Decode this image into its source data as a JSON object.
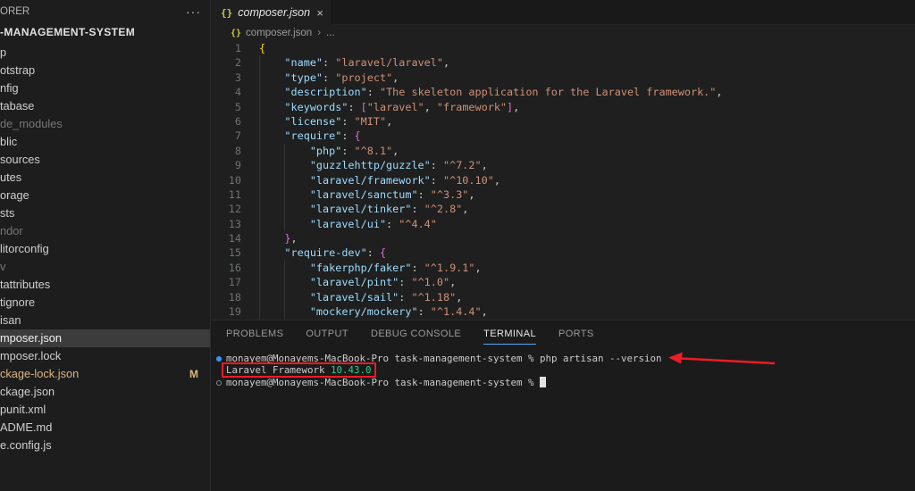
{
  "colors": {
    "annotation_red": "#ed1c24",
    "accent_blue": "#4daafc",
    "version_green": "#23d18b",
    "modified_yellow": "#dcb67f",
    "json_icon_yellow": "#cbcb41",
    "terminal_decoration_blue": "#3794ff"
  },
  "sidebar": {
    "header": "ORER",
    "more_icon": "···",
    "project": "-MANAGEMENT-SYSTEM",
    "items": [
      {
        "label": "p"
      },
      {
        "label": "otstrap"
      },
      {
        "label": "nfig"
      },
      {
        "label": "tabase"
      },
      {
        "label": "de_modules",
        "dim": true
      },
      {
        "label": "blic"
      },
      {
        "label": "sources"
      },
      {
        "label": "utes"
      },
      {
        "label": "orage"
      },
      {
        "label": "sts"
      },
      {
        "label": "ndor",
        "dim": true
      },
      {
        "label": "litorconfig"
      },
      {
        "label": "v",
        "dim": true
      },
      {
        "label": "tattributes"
      },
      {
        "label": "tignore"
      },
      {
        "label": "isan"
      },
      {
        "label": "mposer.json",
        "selected": true
      },
      {
        "label": "mposer.lock"
      },
      {
        "label": "ckage-lock.json",
        "modified": true,
        "badge": "M"
      },
      {
        "label": "ckage.json"
      },
      {
        "label": "punit.xml"
      },
      {
        "label": "ADME.md"
      },
      {
        "label": "e.config.js"
      }
    ]
  },
  "tabbar": {
    "tab": {
      "icon": "{}",
      "label": "composer.json",
      "close": "×"
    }
  },
  "breadcrumb": {
    "icon": "{}",
    "file": "composer.json",
    "separator": "›",
    "tail": "..."
  },
  "editor": {
    "lines": [
      {
        "n": 1,
        "i": 0,
        "t": [
          [
            "{",
            "b1"
          ]
        ]
      },
      {
        "n": 2,
        "i": 4,
        "t": [
          [
            "\"name\"",
            "key"
          ],
          [
            ": ",
            "pun"
          ],
          [
            "\"laravel/laravel\"",
            "str"
          ],
          [
            ",",
            "pun"
          ]
        ]
      },
      {
        "n": 3,
        "i": 4,
        "t": [
          [
            "\"type\"",
            "key"
          ],
          [
            ": ",
            "pun"
          ],
          [
            "\"project\"",
            "str"
          ],
          [
            ",",
            "pun"
          ]
        ]
      },
      {
        "n": 4,
        "i": 4,
        "t": [
          [
            "\"description\"",
            "key"
          ],
          [
            ": ",
            "pun"
          ],
          [
            "\"The skeleton application for the Laravel framework.\"",
            "str"
          ],
          [
            ",",
            "pun"
          ]
        ]
      },
      {
        "n": 5,
        "i": 4,
        "t": [
          [
            "\"keywords\"",
            "key"
          ],
          [
            ": ",
            "pun"
          ],
          [
            "[",
            "b2"
          ],
          [
            "\"laravel\"",
            "str"
          ],
          [
            ", ",
            "pun"
          ],
          [
            "\"framework\"",
            "str"
          ],
          [
            "]",
            "b2"
          ],
          [
            ",",
            "pun"
          ]
        ]
      },
      {
        "n": 6,
        "i": 4,
        "t": [
          [
            "\"license\"",
            "key"
          ],
          [
            ": ",
            "pun"
          ],
          [
            "\"MIT\"",
            "str"
          ],
          [
            ",",
            "pun"
          ]
        ]
      },
      {
        "n": 7,
        "i": 4,
        "t": [
          [
            "\"require\"",
            "key"
          ],
          [
            ": ",
            "pun"
          ],
          [
            "{",
            "b2"
          ]
        ]
      },
      {
        "n": 8,
        "i": 8,
        "t": [
          [
            "\"php\"",
            "key"
          ],
          [
            ": ",
            "pun"
          ],
          [
            "\"^8.1\"",
            "str"
          ],
          [
            ",",
            "pun"
          ]
        ]
      },
      {
        "n": 9,
        "i": 8,
        "t": [
          [
            "\"guzzlehttp/guzzle\"",
            "key"
          ],
          [
            ": ",
            "pun"
          ],
          [
            "\"^7.2\"",
            "str"
          ],
          [
            ",",
            "pun"
          ]
        ]
      },
      {
        "n": 10,
        "i": 8,
        "t": [
          [
            "\"laravel/framework\"",
            "key"
          ],
          [
            ": ",
            "pun"
          ],
          [
            "\"^10.10\"",
            "str"
          ],
          [
            ",",
            "pun"
          ]
        ]
      },
      {
        "n": 11,
        "i": 8,
        "t": [
          [
            "\"laravel/sanctum\"",
            "key"
          ],
          [
            ": ",
            "pun"
          ],
          [
            "\"^3.3\"",
            "str"
          ],
          [
            ",",
            "pun"
          ]
        ]
      },
      {
        "n": 12,
        "i": 8,
        "t": [
          [
            "\"laravel/tinker\"",
            "key"
          ],
          [
            ": ",
            "pun"
          ],
          [
            "\"^2.8\"",
            "str"
          ],
          [
            ",",
            "pun"
          ]
        ]
      },
      {
        "n": 13,
        "i": 8,
        "t": [
          [
            "\"laravel/ui\"",
            "key"
          ],
          [
            ": ",
            "pun"
          ],
          [
            "\"^4.4\"",
            "str"
          ]
        ]
      },
      {
        "n": 14,
        "i": 4,
        "t": [
          [
            "}",
            "b2"
          ],
          [
            ",",
            "pun"
          ]
        ]
      },
      {
        "n": 15,
        "i": 4,
        "t": [
          [
            "\"require-dev\"",
            "key"
          ],
          [
            ": ",
            "pun"
          ],
          [
            "{",
            "b2"
          ]
        ]
      },
      {
        "n": 16,
        "i": 8,
        "t": [
          [
            "\"fakerphp/faker\"",
            "key"
          ],
          [
            ": ",
            "pun"
          ],
          [
            "\"^1.9.1\"",
            "str"
          ],
          [
            ",",
            "pun"
          ]
        ]
      },
      {
        "n": 17,
        "i": 8,
        "t": [
          [
            "\"laravel/pint\"",
            "key"
          ],
          [
            ": ",
            "pun"
          ],
          [
            "\"^1.0\"",
            "str"
          ],
          [
            ",",
            "pun"
          ]
        ]
      },
      {
        "n": 18,
        "i": 8,
        "t": [
          [
            "\"laravel/sail\"",
            "key"
          ],
          [
            ": ",
            "pun"
          ],
          [
            "\"^1.18\"",
            "str"
          ],
          [
            ",",
            "pun"
          ]
        ]
      },
      {
        "n": 19,
        "i": 8,
        "t": [
          [
            "\"mockery/mockery\"",
            "key"
          ],
          [
            ": ",
            "pun"
          ],
          [
            "\"^1.4.4\"",
            "str"
          ],
          [
            ",",
            "pun"
          ]
        ]
      }
    ]
  },
  "panel": {
    "tabs": [
      {
        "label": "PROBLEMS"
      },
      {
        "label": "OUTPUT"
      },
      {
        "label": "DEBUG CONSOLE"
      },
      {
        "label": "TERMINAL",
        "active": true
      },
      {
        "label": "PORTS"
      }
    ],
    "terminal": {
      "lines": [
        {
          "bullet": "filled",
          "segs": [
            [
              "monayem@Monayems-MacBook-Pro task-management-system % php artisan --version",
              "fg"
            ]
          ]
        },
        {
          "boxed": true,
          "segs": [
            [
              "Laravel Framework ",
              "fg"
            ],
            [
              "10.43.0",
              "green"
            ]
          ]
        },
        {
          "bullet": "hollow",
          "segs": [
            [
              "monayem@Monayems-MacBook-Pro task-management-system % ",
              "fg"
            ]
          ],
          "cursor": true
        }
      ]
    }
  }
}
